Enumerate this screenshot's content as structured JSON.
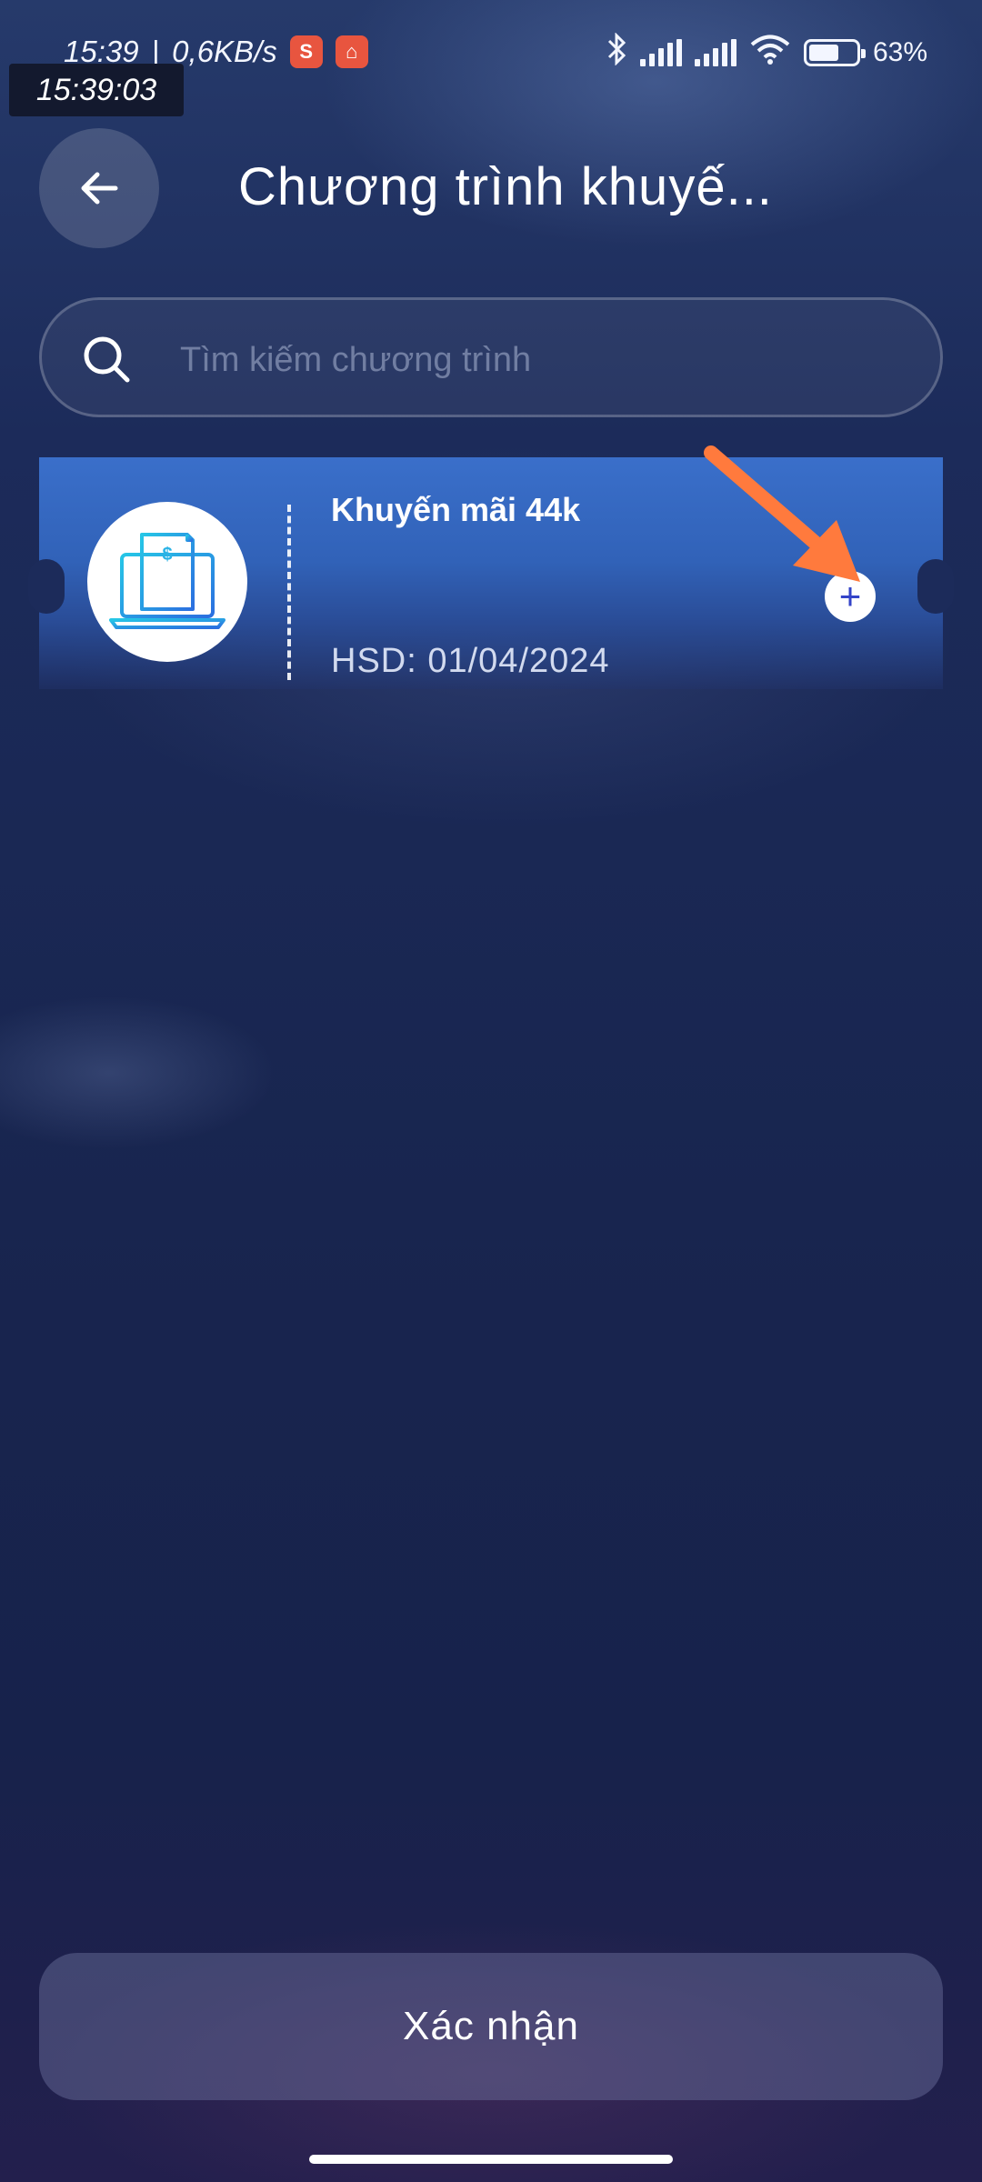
{
  "status_bar": {
    "time": "15:39",
    "net_speed": "0,6KB/s",
    "overlay_time": "15:39:03",
    "battery_percent": "63%",
    "battery_level": 0.63,
    "app_icons": [
      "shopee-icon",
      "shop-icon"
    ]
  },
  "header": {
    "title": "Chương trình khuyế..."
  },
  "search": {
    "placeholder": "Tìm kiếm chương trình",
    "value": ""
  },
  "promotions": [
    {
      "name": "Khuyến mãi 44k",
      "expiry": "HSD: 01/04/2024",
      "icon": "invoice-laptop-icon"
    }
  ],
  "footer": {
    "confirm_label": "Xác nhận"
  },
  "colors": {
    "card_blue": "#3a6fca",
    "arrow_orange": "#ff7a3d",
    "add_icon_blue": "#3444c8"
  }
}
